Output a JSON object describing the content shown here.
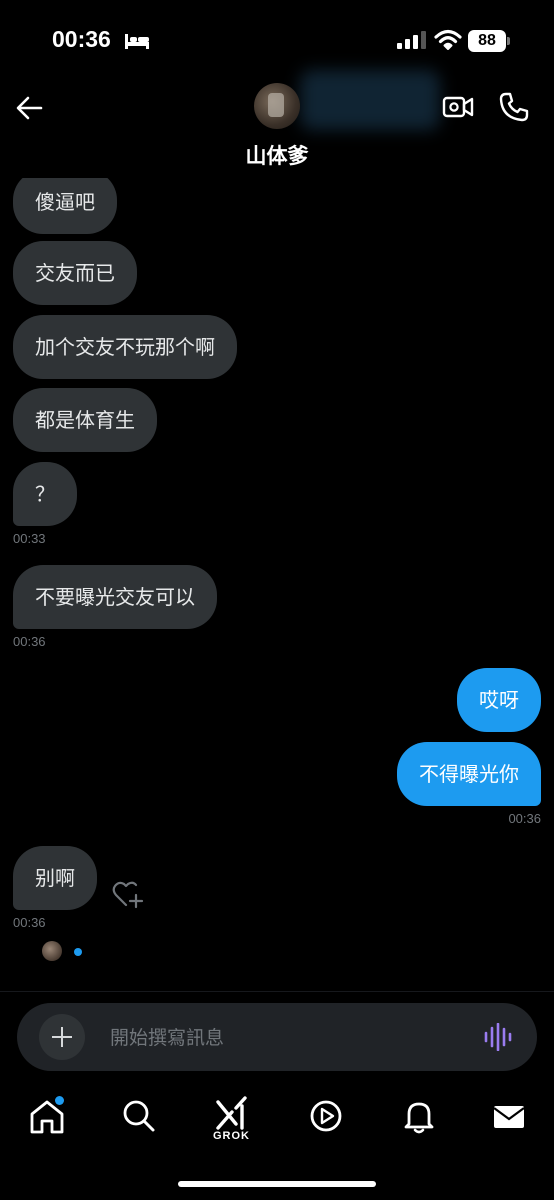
{
  "status_bar": {
    "time": "00:36",
    "battery": "88"
  },
  "header": {
    "contact_name": "山体爹"
  },
  "messages": [
    {
      "text": "傻逼吧",
      "side": "in"
    },
    {
      "text": "交友而已",
      "side": "in"
    },
    {
      "text": "加个交友不玩那个啊",
      "side": "in"
    },
    {
      "text": "都是体育生",
      "side": "in"
    },
    {
      "text": "？",
      "side": "in",
      "time": "00:33"
    },
    {
      "text": "不要曝光交友可以",
      "side": "in",
      "time": "00:36"
    },
    {
      "text": "哎呀",
      "side": "out"
    },
    {
      "text": "不得曝光你",
      "side": "out",
      "time": "00:36"
    },
    {
      "text": "别啊",
      "side": "in",
      "time": "00:36"
    }
  ],
  "composer": {
    "placeholder": "開始撰寫訊息"
  },
  "tabbar": {
    "grok_label": "GROK"
  },
  "colors": {
    "accent": "#1d9bf0",
    "incoming_bubble": "#2f3336",
    "background": "#000000",
    "voice_icon": "#9a7cf0"
  }
}
